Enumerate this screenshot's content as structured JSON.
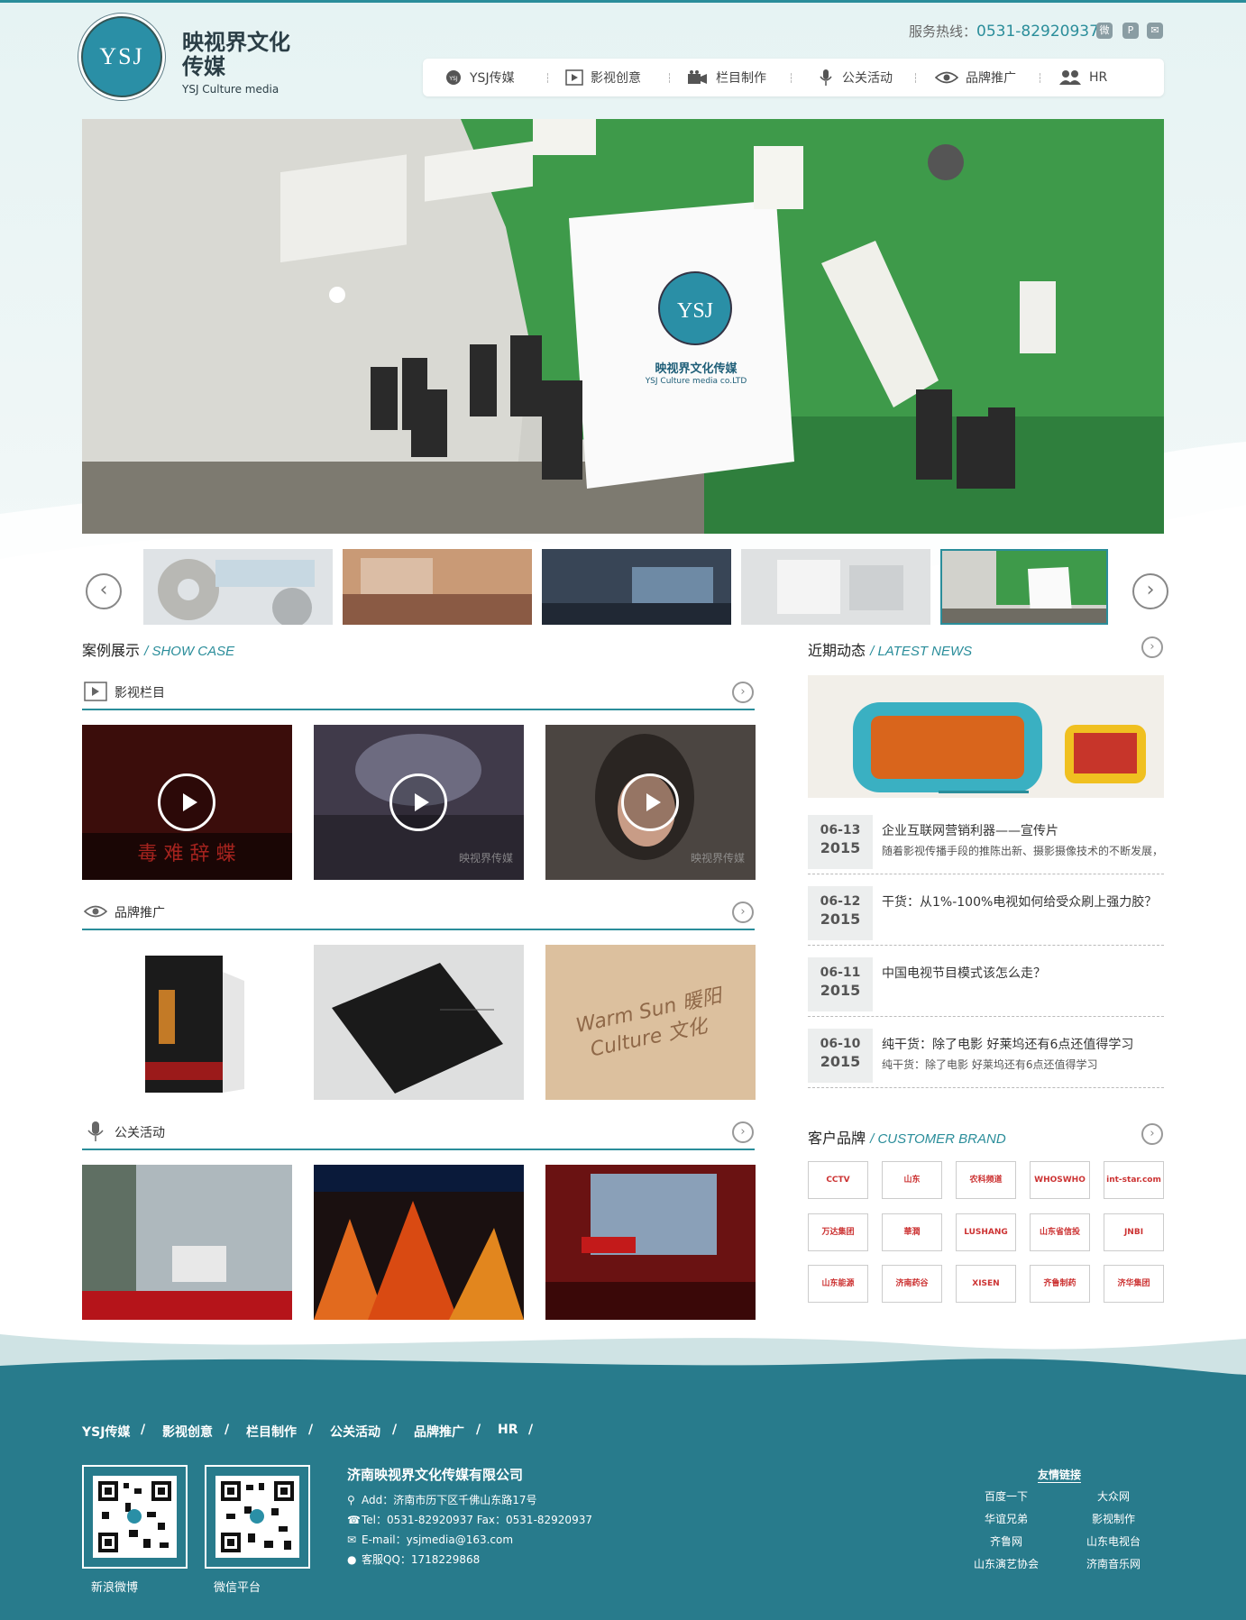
{
  "header": {
    "logo_letters": "YSJ",
    "logo_cn": "映视界文化传媒",
    "logo_en": "YSJ Culture media",
    "hotline_label": "服务热线：",
    "hotline_number": "0531-82920937",
    "social_icons": [
      "weibo-icon",
      "pinterest-icon",
      "wechat-icon"
    ]
  },
  "nav": [
    {
      "label": "YSJ传媒",
      "icon": "ysj-logo-icon"
    },
    {
      "label": "影视创意",
      "icon": "video-icon"
    },
    {
      "label": "栏目制作",
      "icon": "camera-icon"
    },
    {
      "label": "公关活动",
      "icon": "microphone-icon"
    },
    {
      "label": "品牌推广",
      "icon": "eye-icon"
    },
    {
      "label": "HR",
      "icon": "people-icon"
    }
  ],
  "hero": {
    "board_title": "映视界文化传媒",
    "board_sub": "YSJ Culture media co.LTD"
  },
  "cases": {
    "title": "案例展示",
    "title_en": "/ SHOW CASE",
    "video": {
      "label": "影视栏目",
      "watermark": "映视界传媒"
    },
    "brand": {
      "label": "品牌推广"
    },
    "pr": {
      "label": "公关活动"
    }
  },
  "news": {
    "title": "近期动态",
    "title_en": "/ LATEST NEWS",
    "items": [
      {
        "date": "06-13",
        "year": "2015",
        "title": "企业互联网营销利器——宣传片",
        "summary": "随着影视传播手段的推陈出新、摄影摄像技术的不断发展，"
      },
      {
        "date": "06-12",
        "year": "2015",
        "title": "干货：从1%-100%电视如何给受众刷上强力胶？",
        "summary": ""
      },
      {
        "date": "06-11",
        "year": "2015",
        "title": "中国电视节目模式该怎么走？",
        "summary": ""
      },
      {
        "date": "06-10",
        "year": "2015",
        "title": "纯干货：除了电影 好莱坞还有6点还值得学习",
        "summary": "纯干货：除了电影 好莱坞还有6点还值得学习"
      }
    ]
  },
  "customers": {
    "title": "客户品牌",
    "title_en": "/ CUSTOMER BRAND",
    "brands": [
      "CCTV",
      "山东",
      "农科频道",
      "WHOSWHO",
      "int-star.com",
      "万达集团",
      "華潤",
      "LUSHANG",
      "山东省信投",
      "JNBI",
      "山东能源",
      "济南药谷",
      "XISEN",
      "齐鲁制药",
      "济华集团"
    ]
  },
  "footer": {
    "links": [
      "YSJ传媒",
      "影视创意",
      "栏目制作",
      "公关活动",
      "品牌推广",
      "HR"
    ],
    "sep": "/",
    "qr": [
      {
        "label": "新浪微博"
      },
      {
        "label": "微信平台"
      }
    ],
    "company": "济南映视界文化传媒有限公司",
    "address": "Add：济南市历下区千佛山东路17号",
    "tel": "Tel：0531-82920937 Fax：0531-82920937",
    "email": "E-mail：ysjmedia@163.com",
    "qq": "客服QQ：1718229868",
    "friends_title": "友情链接",
    "friends": [
      "百度一下",
      "大众网",
      "华谊兄弟",
      "影视制作",
      "齐鲁网",
      "山东电视台",
      "山东演艺协会",
      "济南音乐网"
    ]
  },
  "colors": {
    "accent": "#2a8d9a",
    "footer_bg": "#287b8c"
  }
}
